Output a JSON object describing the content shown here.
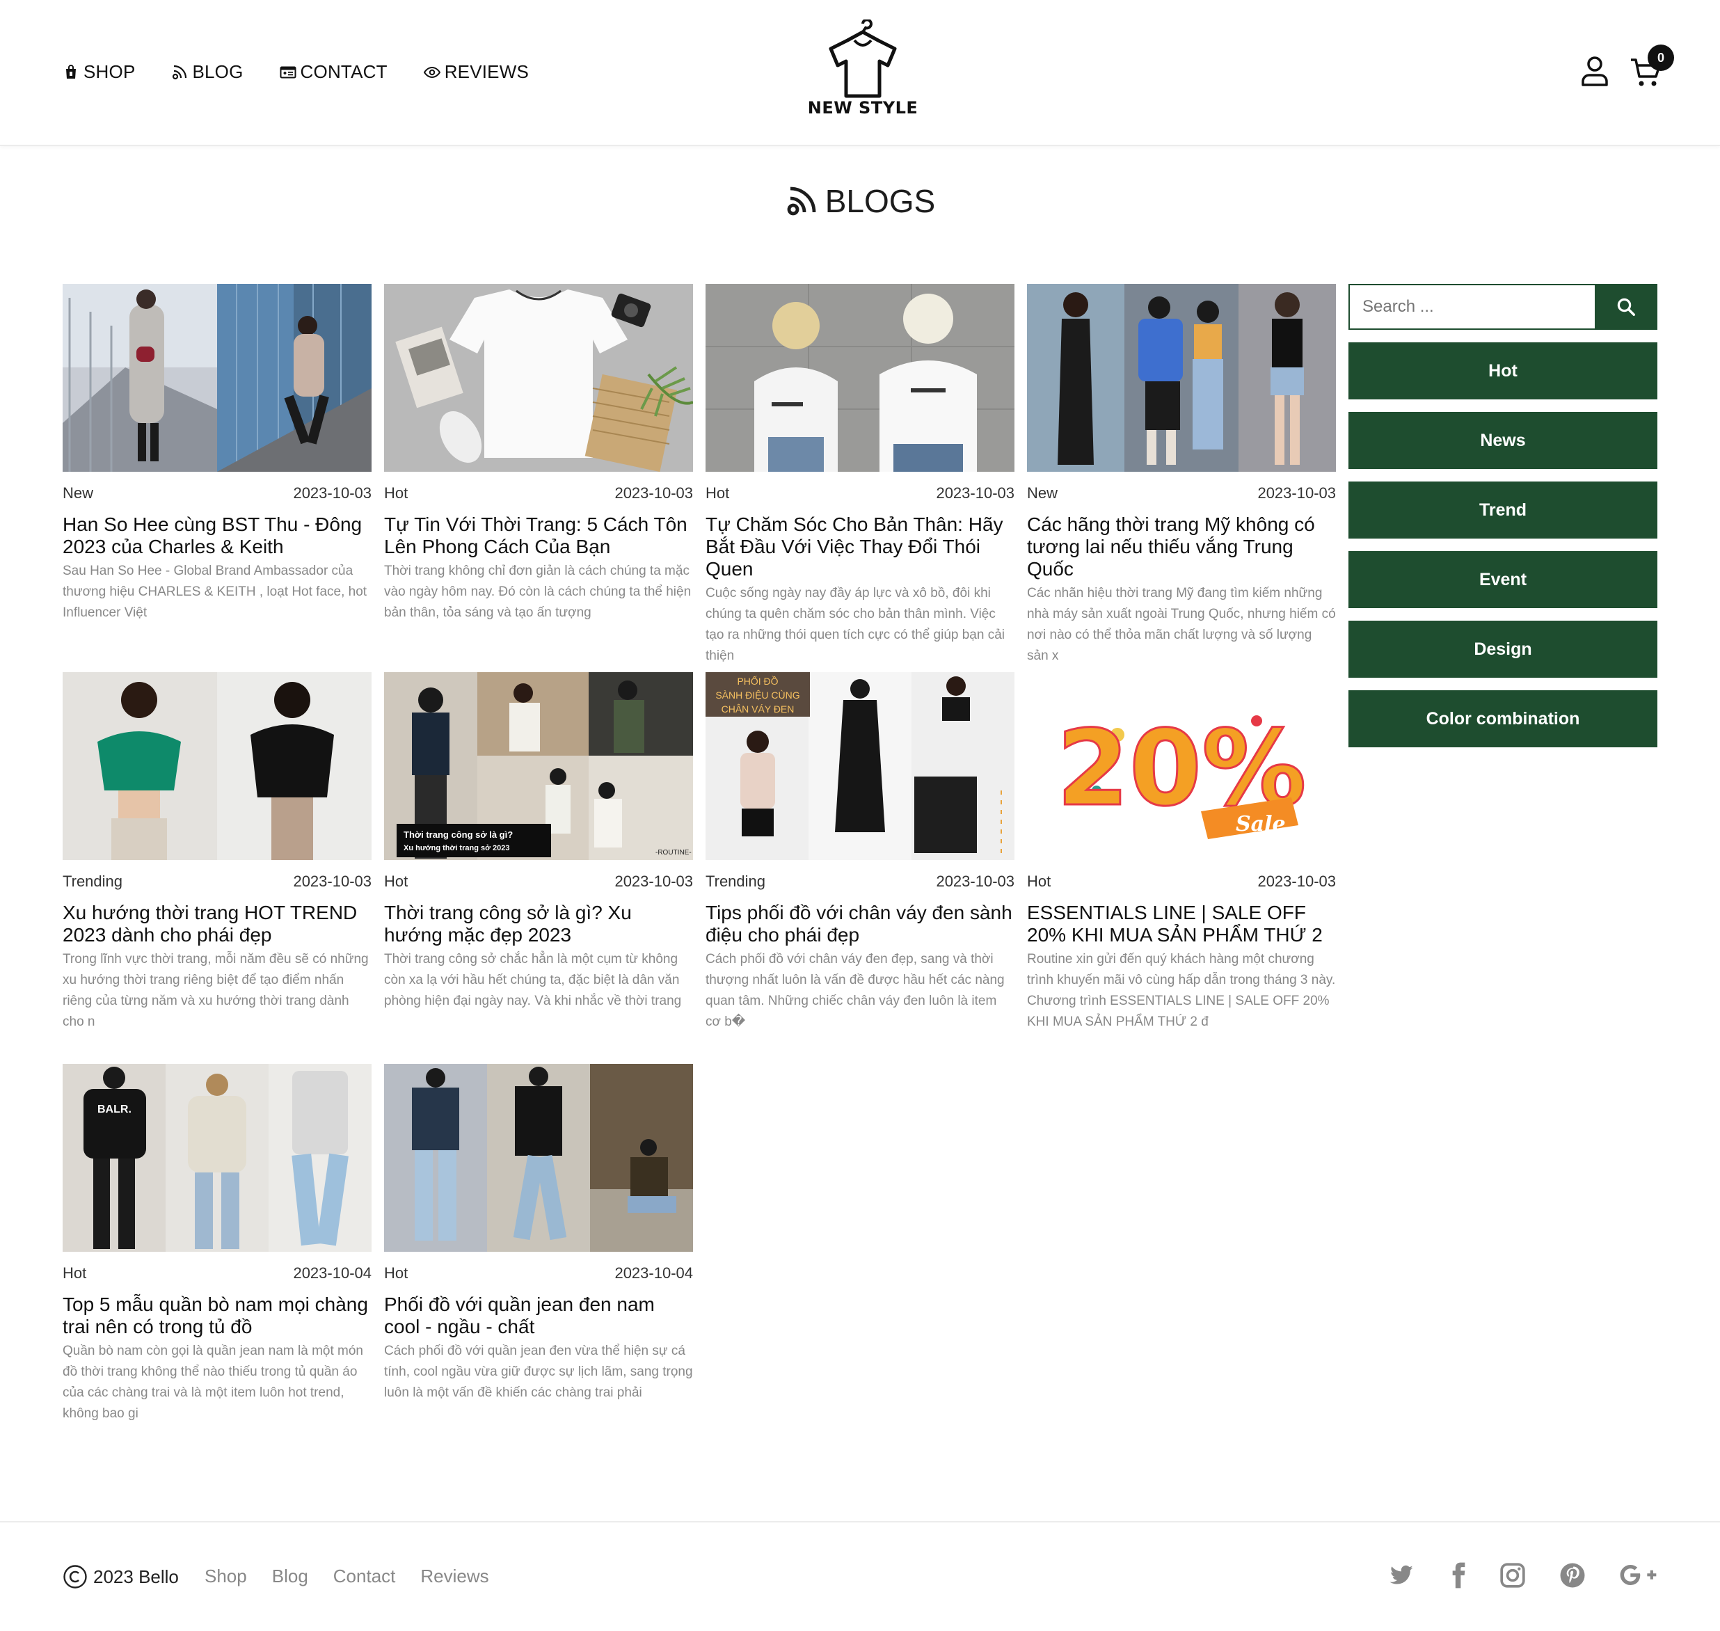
{
  "header": {
    "nav": [
      {
        "label": "SHOP",
        "icon": "shopping-bag-icon"
      },
      {
        "label": "BLOG",
        "icon": "rss-icon"
      },
      {
        "label": "CONTACT",
        "icon": "id-card-icon"
      },
      {
        "label": "REVIEWS",
        "icon": "eye-icon"
      }
    ],
    "logo_text": "NEW STYLE",
    "cart_count": "0"
  },
  "page_title": "BLOGS",
  "posts": [
    {
      "category": "New",
      "date": "2023-10-03",
      "title": "Han So Hee cùng BST Thu - Đông 2023 của Charles & Keith",
      "excerpt": "Sau Han So Hee - Global Brand Ambassador của thương hiệu CHARLES & KEITH , loạt Hot face, hot Influencer Việt"
    },
    {
      "category": "Hot",
      "date": "2023-10-03",
      "title": "Tự Tin Với Thời Trang: 5 Cách Tôn Lên Phong Cách Của Bạn",
      "excerpt": "Thời trang không chỉ đơn giản là cách chúng ta mặc vào ngày hôm nay. Đó còn là cách chúng ta thể hiện bản thân, tỏa sáng và tạo ấn tượng"
    },
    {
      "category": "Hot",
      "date": "2023-10-03",
      "title": "Tự Chăm Sóc Cho Bản Thân: Hãy Bắt Đầu Với Việc Thay Đổi Thói Quen",
      "excerpt": "Cuộc sống ngày nay đầy áp lực và xô bồ, đôi khi chúng ta quên chăm sóc cho bản thân mình. Việc tạo ra những thói quen tích cực có thể giúp bạn cải thiện"
    },
    {
      "category": "New",
      "date": "2023-10-03",
      "title": "Các hãng thời trang Mỹ không có tương lai nếu thiếu vắng Trung Quốc",
      "excerpt": "Các nhãn hiệu thời trang Mỹ đang tìm kiếm những nhà máy sản xuất ngoài Trung Quốc, nhưng hiếm có nơi nào có thể thỏa mãn chất lượng và số lượng sản x"
    },
    {
      "category": "Trending",
      "date": "2023-10-03",
      "title": "Xu hướng thời trang HOT TREND 2023 dành cho phái đẹp",
      "excerpt": "Trong lĩnh vực thời trang, mỗi năm đều sẽ có những xu hướng thời trang riêng biệt để tạo điểm nhấn riêng của từng năm và xu hướng thời trang dành cho n"
    },
    {
      "category": "Hot",
      "date": "2023-10-03",
      "title": "Thời trang công sở là gì? Xu hướng mặc đẹp 2023",
      "excerpt": "Thời trang công sở chắc hẳn là một cụm từ không còn xa lạ với hầu hết chúng ta, đặc biệt là dân văn phòng hiện đại ngày nay. Và khi nhắc về thời trang",
      "thumb_caption_1": "Thời trang công sở là gì?",
      "thumb_caption_2": "Xu hướng thời trang sở 2023",
      "thumb_brand": "-ROUTINE-"
    },
    {
      "category": "Trending",
      "date": "2023-10-03",
      "title": "Tips phối đồ với chân váy đen sành điệu cho phái đẹp",
      "excerpt": "Cách phối đồ với chân váy đen đẹp, sang và thời thượng nhất luôn là vấn đề được hầu hết các nàng quan tâm. Những chiếc chân váy đen luôn là item cơ b�",
      "thumb_caption_1": "PHỐI ĐỒ",
      "thumb_caption_2": "SÀNH ĐIỆU CÙNG",
      "thumb_caption_3": "CHÂN VÁY ĐEN"
    },
    {
      "category": "Hot",
      "date": "2023-10-03",
      "title": "ESSENTIALS LINE | SALE OFF 20% KHI MUA SẢN PHẨM THỨ 2",
      "excerpt": "Routine xin gửi đến quý khách hàng một chương trình khuyến mãi vô cùng hấp dẫn trong tháng 3 này. Chương trình ESSENTIALS LINE | SALE OFF 20% KHI MUA SẢN PHẨM THỨ 2 đ",
      "thumb_big": "20%",
      "thumb_sale": "Sale"
    },
    {
      "category": "Hot",
      "date": "2023-10-04",
      "title": "Top 5 mẫu quần bò nam mọi chàng trai nên có trong tủ đồ",
      "excerpt": "Quần bò nam còn gọi là quần jean nam là một món đồ thời trang không thể nào thiếu trong tủ quần áo của các chàng trai và là một item luôn hot trend, không bao gi",
      "thumb_brand": "BALR."
    },
    {
      "category": "Hot",
      "date": "2023-10-04",
      "title": "Phối đồ với quần jean đen nam cool - ngầu - chất",
      "excerpt": "Cách phối đồ với quần jean đen vừa thể hiện sự cá tính, cool ngầu vừa giữ được sự lịch lãm, sang trọng luôn là một vấn đề khiến các chàng trai phải"
    }
  ],
  "sidebar": {
    "search_placeholder": "Search ...",
    "categories": [
      "Hot",
      "News",
      "Trend",
      "Event",
      "Design",
      "Color combination"
    ]
  },
  "footer": {
    "copyright": "2023 Bello",
    "links": [
      "Shop",
      "Blog",
      "Contact",
      "Reviews"
    ],
    "social": [
      "twitter-icon",
      "facebook-icon",
      "instagram-icon",
      "pinterest-icon",
      "google-plus-icon"
    ]
  },
  "colors": {
    "accent": "#1e4d2f",
    "text_muted": "#888888"
  }
}
